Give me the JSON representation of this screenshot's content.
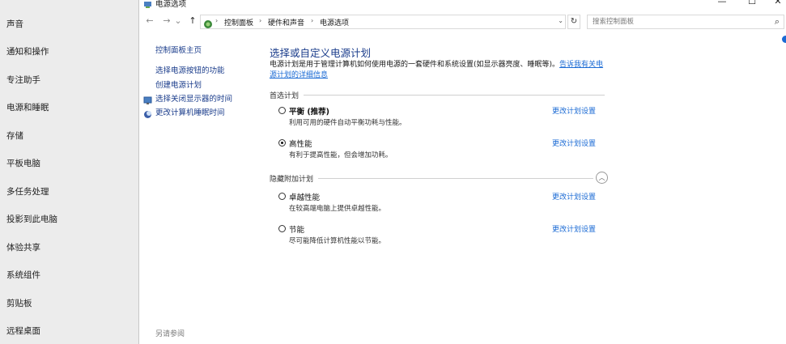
{
  "settings_nav": {
    "items": [
      "声音",
      "通知和操作",
      "专注助手",
      "电源和睡眠",
      "存储",
      "平板电脑",
      "多任务处理",
      "投影到此电脑",
      "体验共享",
      "系统组件",
      "剪贴板",
      "远程桌面"
    ]
  },
  "window": {
    "title": "电源选项",
    "controls": {
      "minimize": "—",
      "maximize": "☐",
      "close": "✕"
    }
  },
  "address_bar": {
    "back": "←",
    "forward": "→",
    "recent": "⌄",
    "up": "↑",
    "breadcrumbs": [
      "控制面板",
      "硬件和声音",
      "电源选项"
    ],
    "separator": "›",
    "dropdown": "⌄",
    "refresh": "↻",
    "search_placeholder": "搜索控制面板",
    "search_icon": "⌕"
  },
  "tasks": {
    "home": "控制面板主页",
    "links": [
      "选择电源按钮的功能",
      "创建电源计划",
      "选择关闭显示器的时间",
      "更改计算机睡眠时间"
    ],
    "see_also": "另请参阅"
  },
  "main": {
    "title": "选择或自定义电源计划",
    "description": "电源计划是用于管理计算机如何使用电源的一套硬件和系统设置(如显示器亮度、睡眠等)。",
    "description_link": "告诉我有关电源计划的详细信息",
    "preferred_group": "首选计划",
    "hidden_group": "隐藏附加计划",
    "collapse_icon": "︿",
    "change_link": "更改计划设置",
    "plans": [
      {
        "name": "平衡",
        "suffix": " (推荐)",
        "desc": "利用可用的硬件自动平衡功耗与性能。",
        "checked": false
      },
      {
        "name": "高性能",
        "suffix": "",
        "desc": "有利于提高性能，但会增加功耗。",
        "checked": true
      },
      {
        "name": "卓越性能",
        "suffix": "",
        "desc": "在较高端电脑上提供卓越性能。",
        "checked": false
      },
      {
        "name": "节能",
        "suffix": "",
        "desc": "尽可能降低计算机性能以节能。",
        "checked": false
      }
    ]
  },
  "colors": {
    "link": "#1a6ad4",
    "heading": "#1a3c8b",
    "sidebar_bg": "#ececec"
  }
}
